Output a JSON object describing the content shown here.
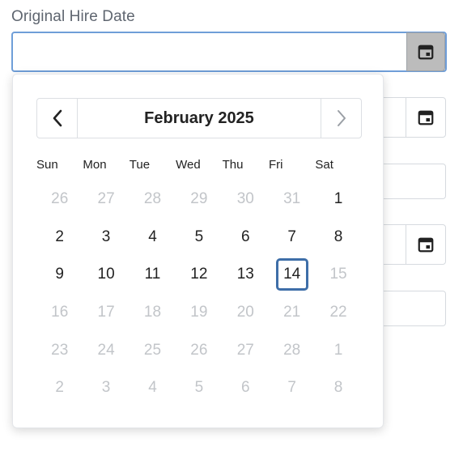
{
  "field": {
    "label": "Original Hire Date",
    "value": "",
    "icon": "calendar-icon"
  },
  "calendar": {
    "month_label": "February 2025",
    "prev_icon": "chevron-left-icon",
    "next_icon": "chevron-right-icon",
    "weekdays": [
      "Sun",
      "Mon",
      "Tue",
      "Wed",
      "Thu",
      "Fri",
      "Sat"
    ],
    "weeks": [
      [
        {
          "d": "26",
          "m": true
        },
        {
          "d": "27",
          "m": true
        },
        {
          "d": "28",
          "m": true
        },
        {
          "d": "29",
          "m": true
        },
        {
          "d": "30",
          "m": true
        },
        {
          "d": "31",
          "m": true
        },
        {
          "d": "1",
          "m": false
        }
      ],
      [
        {
          "d": "2",
          "m": false
        },
        {
          "d": "3",
          "m": false
        },
        {
          "d": "4",
          "m": false
        },
        {
          "d": "5",
          "m": false
        },
        {
          "d": "6",
          "m": false
        },
        {
          "d": "7",
          "m": false
        },
        {
          "d": "8",
          "m": false
        }
      ],
      [
        {
          "d": "9",
          "m": false
        },
        {
          "d": "10",
          "m": false
        },
        {
          "d": "11",
          "m": false
        },
        {
          "d": "12",
          "m": false
        },
        {
          "d": "13",
          "m": false
        },
        {
          "d": "14",
          "m": false,
          "selected": true
        },
        {
          "d": "15",
          "m": true
        }
      ],
      [
        {
          "d": "16",
          "m": true
        },
        {
          "d": "17",
          "m": true
        },
        {
          "d": "18",
          "m": true
        },
        {
          "d": "19",
          "m": true
        },
        {
          "d": "20",
          "m": true
        },
        {
          "d": "21",
          "m": true
        },
        {
          "d": "22",
          "m": true
        }
      ],
      [
        {
          "d": "23",
          "m": true
        },
        {
          "d": "24",
          "m": true
        },
        {
          "d": "25",
          "m": true
        },
        {
          "d": "26",
          "m": true
        },
        {
          "d": "27",
          "m": true
        },
        {
          "d": "28",
          "m": true
        },
        {
          "d": "1",
          "m": true
        }
      ],
      [
        {
          "d": "2",
          "m": true
        },
        {
          "d": "3",
          "m": true
        },
        {
          "d": "4",
          "m": true
        },
        {
          "d": "5",
          "m": true
        },
        {
          "d": "6",
          "m": true
        },
        {
          "d": "7",
          "m": true
        },
        {
          "d": "8",
          "m": true
        }
      ]
    ]
  },
  "colors": {
    "focus_border": "#6f9ed8",
    "selected_border": "#3e6ea8",
    "muted_text": "#c2c5c9",
    "label_text": "#5f6670"
  }
}
